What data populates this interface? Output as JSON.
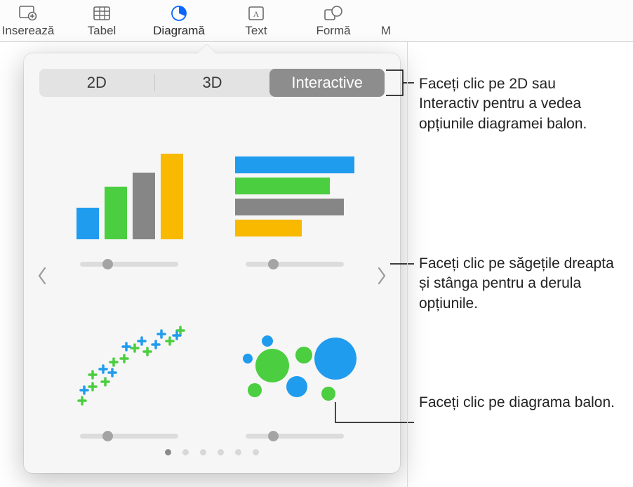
{
  "toolbar": {
    "items": [
      {
        "label": "Inserează",
        "icon": "insert"
      },
      {
        "label": "Tabel",
        "icon": "table"
      },
      {
        "label": "Diagramă",
        "icon": "chart",
        "active": true
      },
      {
        "label": "Text",
        "icon": "text"
      },
      {
        "label": "Formă",
        "icon": "shape"
      },
      {
        "label": "M",
        "icon": "none"
      }
    ]
  },
  "popover": {
    "tabs": {
      "t2d": "2D",
      "t3d": "3D",
      "interactive": "Interactive",
      "selected": "Interactive"
    },
    "chart_types": [
      "column-chart",
      "bar-chart",
      "scatter-chart",
      "bubble-chart"
    ],
    "page_count": 6,
    "active_page": 0
  },
  "callouts": {
    "c1": "Faceți clic pe 2D sau Interactiv pentru a vedea opțiunile diagramei balon.",
    "c2": "Faceți clic pe săgețile dreapta și stânga pentru a derula opțiunile.",
    "c3": "Faceți clic pe diagrama balon."
  },
  "colors": {
    "blue": "#1f9cee",
    "green": "#4bce3f",
    "gray": "#868686",
    "yellow": "#f8b900"
  }
}
